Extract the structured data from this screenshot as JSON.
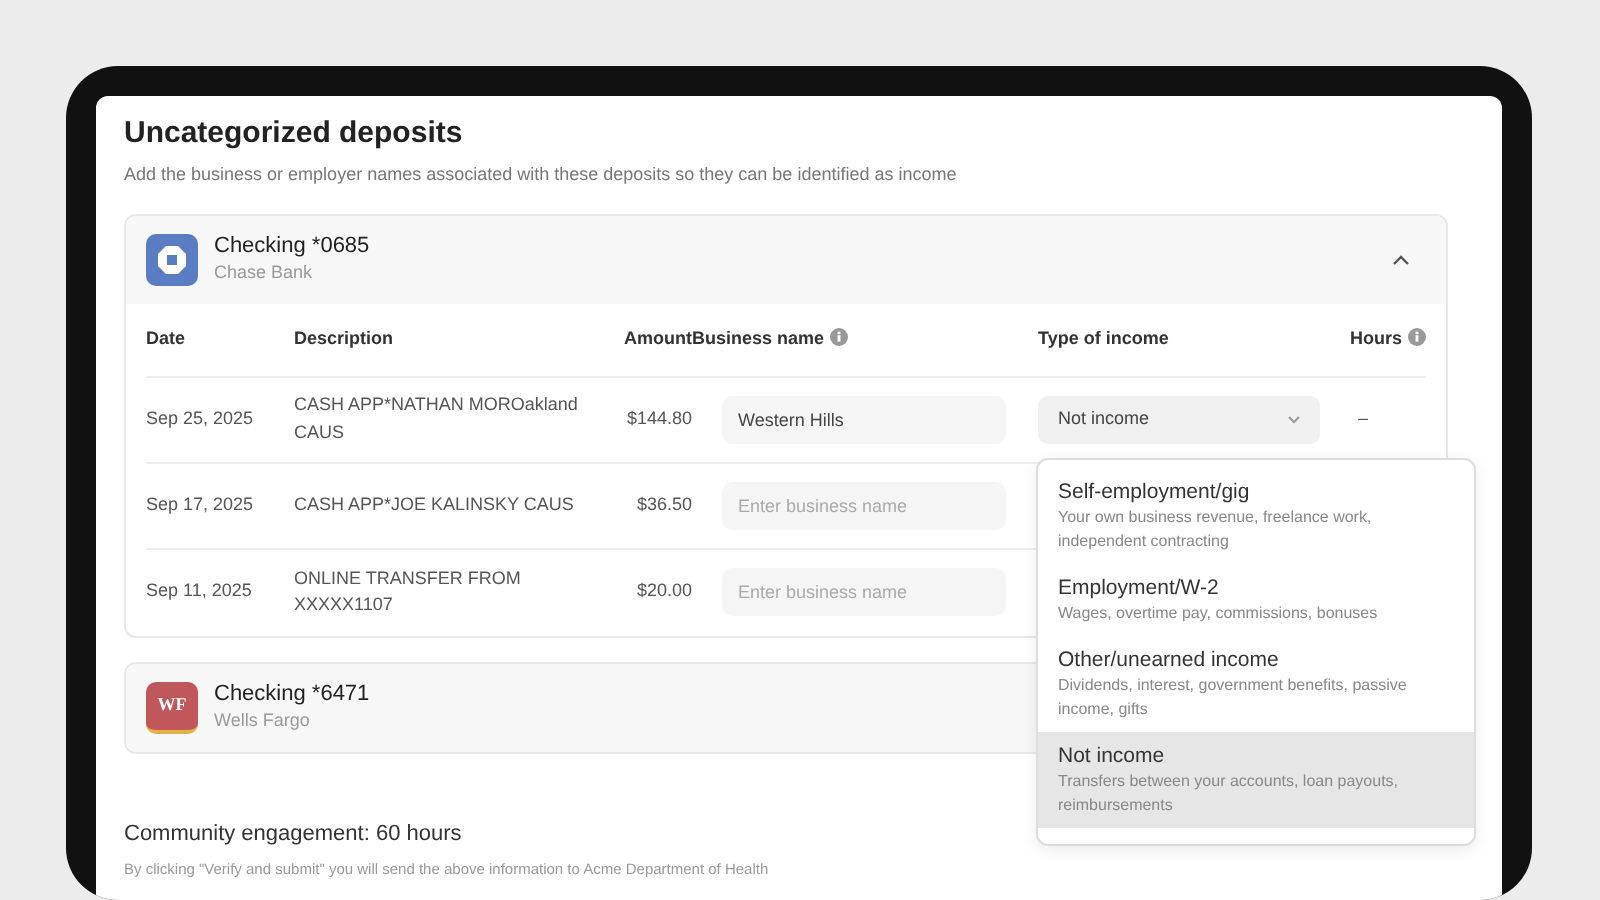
{
  "page": {
    "title": "Uncategorized deposits",
    "subtitle": "Add the business or employer names associated with these deposits so they can be identified as income"
  },
  "accounts": [
    {
      "name": "Checking *0685",
      "bank": "Chase Bank",
      "expanded": true,
      "columns": [
        "Date",
        "Description",
        "Amount",
        "Business name",
        "Type of income",
        "Hours"
      ],
      "rows": [
        {
          "date": "Sep 25, 2025",
          "description": "CASH APP*NATHAN MOROakland CAUS",
          "amount": "$144.80",
          "business": {
            "value": "Western Hills"
          },
          "income_type": {
            "value": "Not income",
            "open": true
          },
          "hours": "–"
        },
        {
          "date": "Sep 17, 2025",
          "description": "CASH APP*JOE KALINSKY CAUS",
          "amount": "$36.50",
          "business": {
            "placeholder": "Enter business name"
          }
        },
        {
          "date": "Sep 11, 2025",
          "description": "ONLINE TRANSFER FROM XXXXX1107",
          "amount": "$20.00",
          "business": {
            "placeholder": "Enter business name"
          }
        }
      ]
    },
    {
      "name": "Checking *6471",
      "bank": "Wells Fargo",
      "logo_text": "WF",
      "expanded": false
    }
  ],
  "income_menu": [
    {
      "label": "Self-employment/gig",
      "hint": "Your own business revenue, freelance work, independent contracting",
      "selected": false
    },
    {
      "label": "Employment/W-2",
      "hint": "Wages, overtime pay, commissions, bonuses",
      "selected": false
    },
    {
      "label": "Other/unearned income",
      "hint": "Dividends, interest, government benefits, passive income, gifts",
      "selected": false
    },
    {
      "label": "Not income",
      "hint": "Transfers between your accounts, loan payouts, reimbursements",
      "selected": true
    }
  ],
  "summary": {
    "title": "Community engagement: 60 hours",
    "note": "By clicking \"Verify and submit\" you will send the above information to Acme Department of Health"
  }
}
